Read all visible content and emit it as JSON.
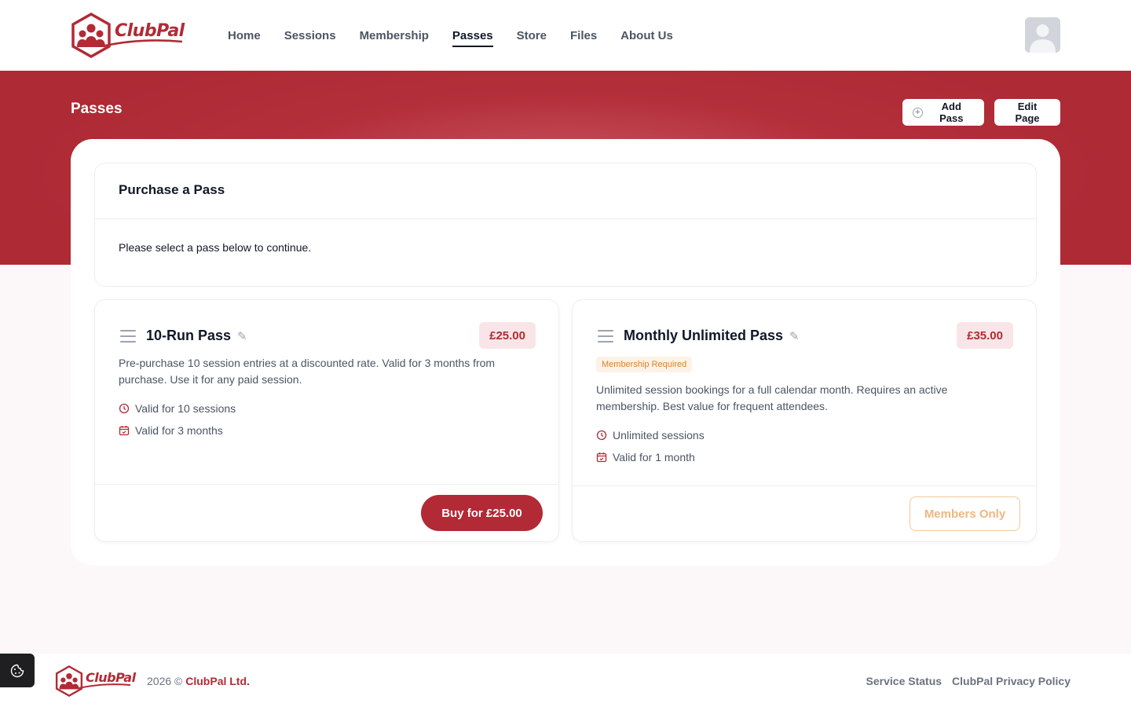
{
  "brand": {
    "name": "ClubPal",
    "primary_color": "#b22a35",
    "icon": "clubpal-hex-people-logo"
  },
  "nav": {
    "items": [
      {
        "label": "Home"
      },
      {
        "label": "Sessions"
      },
      {
        "label": "Membership"
      },
      {
        "label": "Passes",
        "active": true
      },
      {
        "label": "Store"
      },
      {
        "label": "Files"
      },
      {
        "label": "About Us"
      }
    ]
  },
  "user": {
    "avatar_icon": "default-user-avatar-icon"
  },
  "page": {
    "title": "Passes",
    "add_pass_label": "Add Pass",
    "edit_page_label": "Edit Page"
  },
  "purchase": {
    "heading": "Purchase a Pass",
    "instruction": "Please select a pass below to continue."
  },
  "passes": [
    {
      "name": "10-Run Pass",
      "price": "£25.00",
      "description": "Pre-purchase 10 session entries at a discounted rate. Valid for 3 months from purchase. Use it for any paid session.",
      "features": [
        "Valid for 10 sessions",
        "Valid for 3 months"
      ],
      "action_label": "Buy for £25.00"
    },
    {
      "name": "Monthly Unlimited Pass",
      "price": "£35.00",
      "tag": "Membership Required",
      "description": "Unlimited session bookings for a full calendar month. Requires an active membership. Best value for frequent attendees.",
      "features": [
        "Unlimited sessions",
        "Valid for 1 month"
      ],
      "action_label": "Members Only"
    }
  ],
  "footer": {
    "copyright_prefix": "2026 ©",
    "company": "ClubPal Ltd.",
    "links": [
      "Service Status",
      "ClubPal Privacy Policy"
    ],
    "cookie_icon": "cookie-icon"
  }
}
